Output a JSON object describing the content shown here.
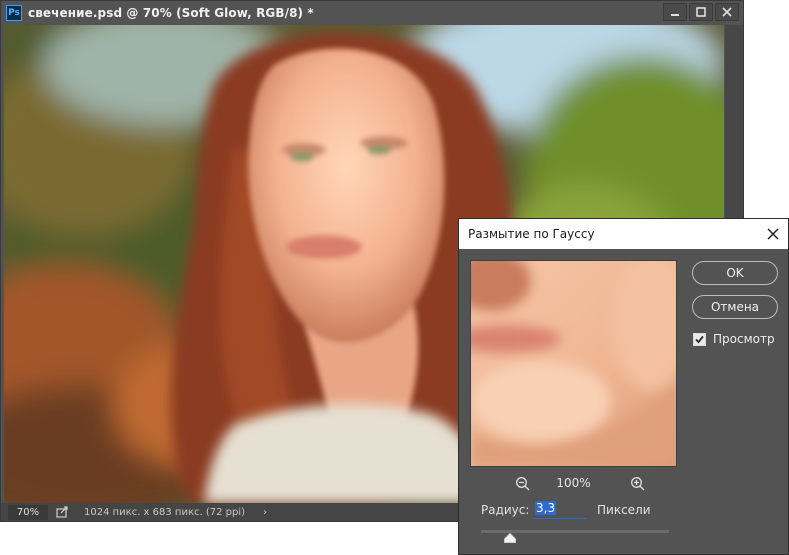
{
  "document": {
    "title": "свечение.psd @ 70% (Soft Glow, RGB/8) *",
    "app_logo": "Ps",
    "status": {
      "zoom": "70%",
      "info": "1024 пикс. x 683 пикс. (72 ppi)",
      "arrow": "›"
    }
  },
  "dialog": {
    "title": "Размытие по Гауссу",
    "ok_label": "OK",
    "cancel_label": "Отмена",
    "preview_label": "Просмотр",
    "preview_checked": true,
    "zoom_value": "100%",
    "radius_label": "Радиус:",
    "radius_value": "3,3",
    "radius_unit": "Пиксели"
  },
  "icons": {
    "minimize": "minimize-icon",
    "maximize": "maximize-icon",
    "close": "close-icon",
    "zoom_out": "zoom-out-icon",
    "zoom_in": "zoom-in-icon",
    "share": "share-icon",
    "slider": "slider-thumb-icon"
  },
  "colors": {
    "panel": "#535353",
    "accent": "#2c6ad0"
  }
}
